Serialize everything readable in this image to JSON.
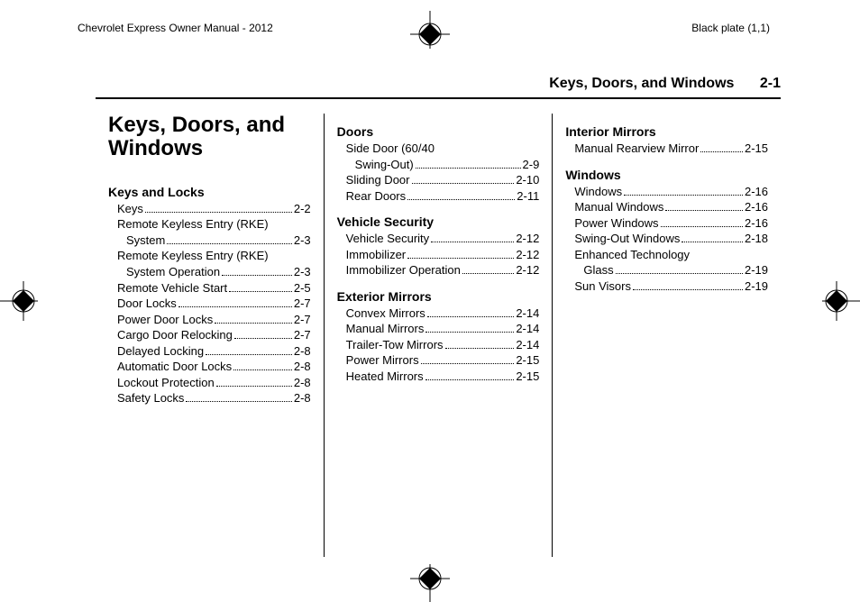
{
  "header": {
    "left": "Chevrolet Express Owner Manual - 2012",
    "right": "Black plate (1,1)"
  },
  "running_head": {
    "title": "Keys, Doors, and Windows",
    "page": "2-1"
  },
  "chapter_title": "Keys, Doors, and Windows",
  "columns": [
    [
      {
        "heading": "Keys and Locks",
        "entries": [
          {
            "label": "Keys",
            "page": "2-2"
          },
          {
            "label": "Remote Keyless Entry (RKE)",
            "cont": "System",
            "page": "2-3"
          },
          {
            "label": "Remote Keyless Entry (RKE)",
            "cont": "System Operation",
            "page": "2-3"
          },
          {
            "label": "Remote Vehicle Start",
            "page": "2-5"
          },
          {
            "label": "Door Locks",
            "page": "2-7"
          },
          {
            "label": "Power Door Locks",
            "page": "2-7"
          },
          {
            "label": "Cargo Door Relocking",
            "page": "2-7"
          },
          {
            "label": "Delayed Locking",
            "page": "2-8"
          },
          {
            "label": "Automatic Door Locks",
            "page": "2-8"
          },
          {
            "label": "Lockout Protection",
            "page": "2-8"
          },
          {
            "label": "Safety Locks",
            "page": "2-8"
          }
        ]
      }
    ],
    [
      {
        "heading": "Doors",
        "entries": [
          {
            "label": "Side Door (60/40",
            "cont": "Swing-Out)",
            "page": "2-9"
          },
          {
            "label": "Sliding Door",
            "page": "2-10"
          },
          {
            "label": "Rear Doors",
            "page": "2-11"
          }
        ]
      },
      {
        "heading": "Vehicle Security",
        "entries": [
          {
            "label": "Vehicle Security",
            "page": "2-12"
          },
          {
            "label": "Immobilizer",
            "page": "2-12"
          },
          {
            "label": "Immobilizer Operation",
            "page": "2-12"
          }
        ]
      },
      {
        "heading": "Exterior Mirrors",
        "entries": [
          {
            "label": "Convex Mirrors",
            "page": "2-14"
          },
          {
            "label": "Manual Mirrors",
            "page": "2-14"
          },
          {
            "label": "Trailer-Tow Mirrors",
            "page": "2-14"
          },
          {
            "label": "Power Mirrors",
            "page": "2-15"
          },
          {
            "label": "Heated Mirrors",
            "page": "2-15"
          }
        ]
      }
    ],
    [
      {
        "heading": "Interior Mirrors",
        "entries": [
          {
            "label": "Manual Rearview Mirror",
            "page": "2-15"
          }
        ]
      },
      {
        "heading": "Windows",
        "entries": [
          {
            "label": "Windows",
            "page": "2-16"
          },
          {
            "label": "Manual Windows",
            "page": "2-16"
          },
          {
            "label": "Power Windows",
            "page": "2-16"
          },
          {
            "label": "Swing-Out Windows",
            "page": "2-18"
          },
          {
            "label": "Enhanced Technology",
            "cont": "Glass",
            "page": "2-19"
          },
          {
            "label": "Sun Visors",
            "page": "2-19"
          }
        ]
      }
    ]
  ]
}
